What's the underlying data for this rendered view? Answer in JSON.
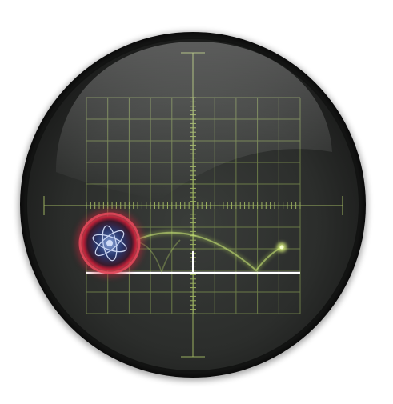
{
  "colors": {
    "page_background": "#ffffff",
    "bezel": "#1a1b1a",
    "screen": "#2c2e2c",
    "grid": "#8da05a",
    "trace_glow": "#d8ff6a",
    "baseline": "#ffffff",
    "orb_ring": "#c2283a",
    "atom": "#dce6ff"
  },
  "icons": {
    "orb": "atom-icon"
  }
}
